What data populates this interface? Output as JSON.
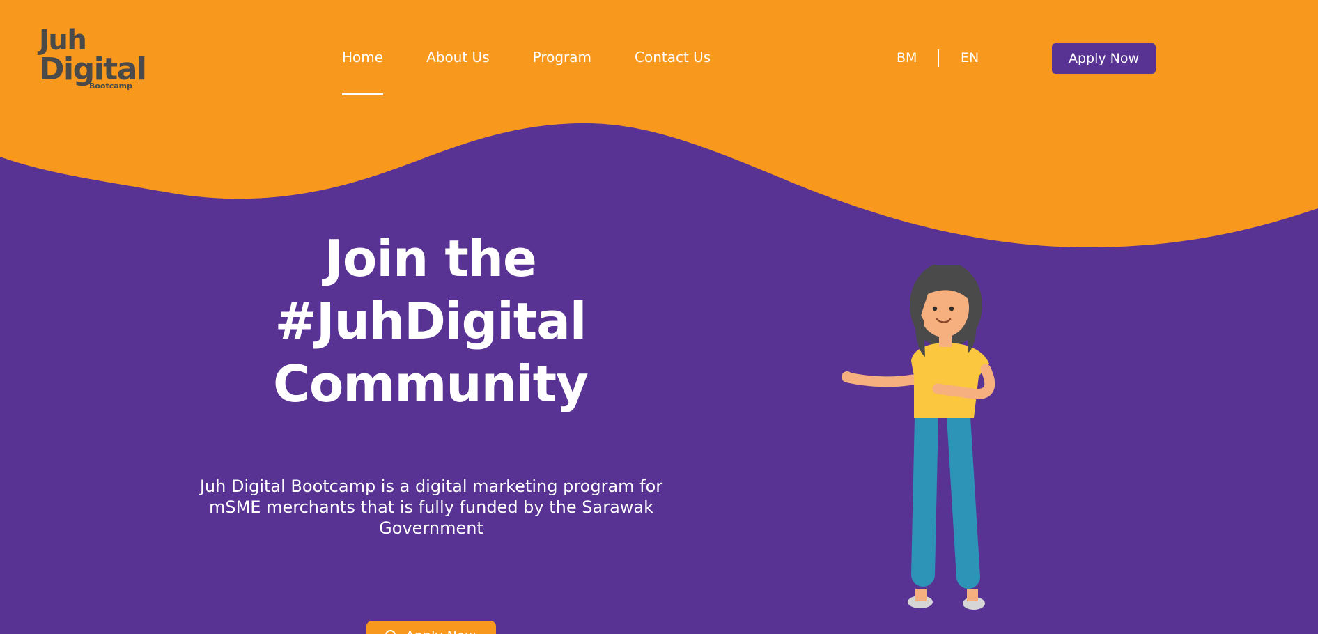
{
  "brand": {
    "logo_line1": "Juh",
    "logo_line2": "Digital",
    "logo_line3": "Bootcamp"
  },
  "nav": {
    "items": [
      {
        "label": "Home",
        "active": true
      },
      {
        "label": "About Us",
        "active": false
      },
      {
        "label": "Program",
        "active": false
      },
      {
        "label": "Contact Us",
        "active": false
      }
    ]
  },
  "language": {
    "options": [
      "BM",
      "EN"
    ]
  },
  "header": {
    "apply_label": "Apply Now"
  },
  "hero": {
    "title_line1": "Join the",
    "title_line2": "#JuhDigital",
    "title_line3": "Community",
    "description": "Juh Digital Bootcamp is a digital marketing program for mSME merchants that is fully funded by the Sarawak Government",
    "button_label": "Apply Now",
    "button_icon": "search-icon",
    "illustration": "woman-pointing-illustration"
  },
  "colors": {
    "orange": "#f8991d",
    "purple": "#583393",
    "logo_text": "#4a4a4a",
    "white": "#ffffff"
  }
}
